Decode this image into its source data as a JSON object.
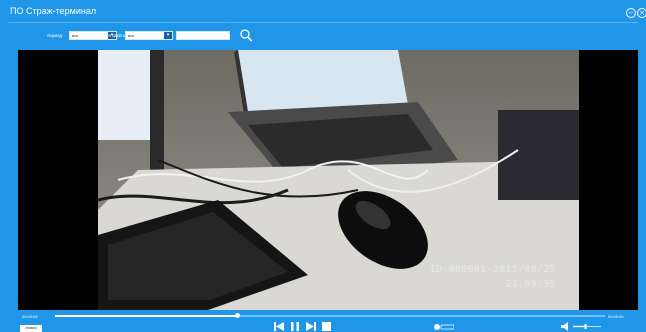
{
  "window": {
    "title": "ПО Страж-терминал",
    "minimize_symbol": "−",
    "close_symbol": "×"
  },
  "filters": {
    "period_label": "период",
    "period_value": "все",
    "filetype_label": "тип файла",
    "filetype_value": "все",
    "search_value": ""
  },
  "video": {
    "osd_id_line": "ID:000001-2015/08/25",
    "osd_time_line": "21:09:35"
  },
  "playback": {
    "current_time": "00:00:08",
    "total_time": "00:00:00",
    "progress": 0.33,
    "left_button_label": "снимок",
    "volume_level": 0.45
  },
  "colors": {
    "accent": "#1f96e8",
    "video_bg": "#000000"
  },
  "icons": {
    "search": "search-icon",
    "prev": "skip-previous-icon",
    "pause": "pause-icon",
    "next": "skip-next-icon",
    "stop": "stop-icon",
    "speed": "speed-icon",
    "volume": "volume-icon"
  }
}
